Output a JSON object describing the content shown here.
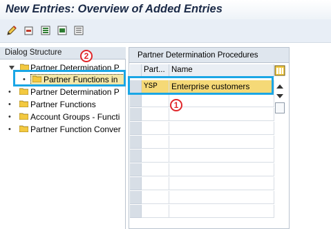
{
  "window": {
    "title": "New Entries: Overview of Added Entries"
  },
  "toolbar": {
    "icons": [
      "edit-pencil-icon",
      "delete-entry-icon",
      "select-all-icon",
      "select-block-icon",
      "deselect-all-icon"
    ]
  },
  "dialog_structure": {
    "header": "Dialog Structure",
    "items": [
      {
        "label": "Partner Determination P",
        "expanded": true
      },
      {
        "label": "Partner Functions in",
        "selected": true
      },
      {
        "label": "Partner Determination P"
      },
      {
        "label": "Partner Functions"
      },
      {
        "label": "Account Groups - Functi"
      },
      {
        "label": "Partner Function Conver"
      }
    ]
  },
  "table": {
    "title": "Partner Determination Procedures",
    "columns": [
      "Part...",
      "Name"
    ],
    "rows": [
      {
        "code": "YSP",
        "name": "Enterprise customers"
      }
    ]
  },
  "annotations": {
    "marker1": "1",
    "marker2": "2"
  },
  "colors": {
    "annotation_box": "#1aa6e5",
    "annotation_marker": "#e0262a",
    "row_highlight": "#f5d977"
  }
}
